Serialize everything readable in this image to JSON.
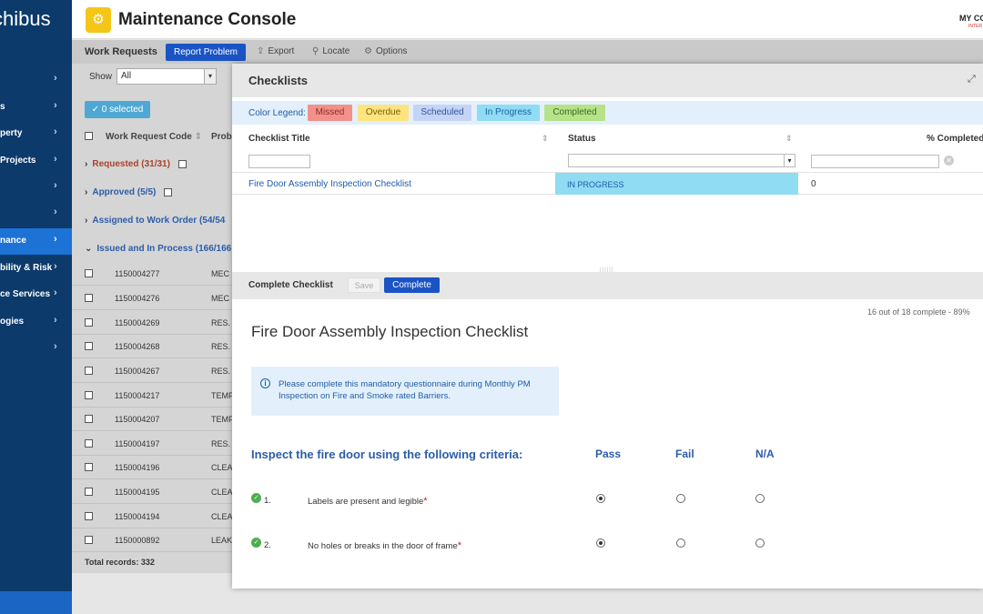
{
  "sidebar": {
    "brand": "chibus",
    "items": [
      {
        "label": ""
      },
      {
        "label": "s"
      },
      {
        "label": "perty"
      },
      {
        "label": "Projects"
      },
      {
        "label": ""
      },
      {
        "label": ""
      },
      {
        "label": "nance"
      },
      {
        "label": "bility & Risk"
      },
      {
        "label": "ce Services"
      },
      {
        "label": "ogies"
      },
      {
        "label": ""
      }
    ]
  },
  "header": {
    "title": "Maintenance Console",
    "company": "MY CO",
    "company_sub": "INTER"
  },
  "toolbar": {
    "title": "Work Requests",
    "report_problem": "Report Problem",
    "export": "Export",
    "locate": "Locate",
    "options": "Options"
  },
  "work_requests": {
    "show_label": "Show",
    "show_value": "All",
    "selected": "0 selected",
    "columns": [
      "Work Request Code",
      "Probl"
    ],
    "groups": [
      {
        "label": "Requested (31/31)"
      },
      {
        "label": "Approved (5/5)"
      },
      {
        "label": "Assigned to Work Order (54/54"
      },
      {
        "label": "Issued and In Process (166/166"
      }
    ],
    "rows": [
      {
        "code": "1150004277",
        "problem": "MEC"
      },
      {
        "code": "1150004276",
        "problem": "MEC"
      },
      {
        "code": "1150004269",
        "problem": "RES."
      },
      {
        "code": "1150004268",
        "problem": "RES."
      },
      {
        "code": "1150004267",
        "problem": "RES."
      },
      {
        "code": "1150004217",
        "problem": "TEMP"
      },
      {
        "code": "1150004207",
        "problem": "TEMP"
      },
      {
        "code": "1150004197",
        "problem": "RES."
      },
      {
        "code": "1150004196",
        "problem": "CLEA"
      },
      {
        "code": "1150004195",
        "problem": "CLEA"
      },
      {
        "code": "1150004194",
        "problem": "CLEA"
      },
      {
        "code": "1150000892",
        "problem": "LEAK"
      }
    ],
    "total": "Total records: 332"
  },
  "checklists_modal": {
    "title": "Checklists",
    "legend_label": "Color Legend:",
    "legend": [
      {
        "label": "Missed",
        "bg": "#f4908a",
        "fg": "#8a2c26"
      },
      {
        "label": "Overdue",
        "bg": "#fde47f",
        "fg": "#7a5e08"
      },
      {
        "label": "Scheduled",
        "bg": "#c5d4f5",
        "fg": "#2f52a3"
      },
      {
        "label": "In Progress",
        "bg": "#8fdcf3",
        "fg": "#1f5ca8"
      },
      {
        "label": "Completed",
        "bg": "#b6e28a",
        "fg": "#3c6a1a"
      }
    ],
    "columns": {
      "title": "Checklist Title",
      "status": "Status",
      "pct": "% Completed"
    },
    "row": {
      "title": "Fire Door Assembly Inspection Checklist",
      "status": "IN PROGRESS",
      "pct": "0"
    }
  },
  "complete_checklist": {
    "bar_title": "Complete Checklist",
    "save": "Save",
    "complete": "Complete",
    "progress": "16 out of 18 complete - 89%",
    "title": "Fire Door Assembly Inspection Checklist",
    "info": "Please complete this mandatory questionnaire during Monthly PM Inspection on Fire and Smoke rated Barriers.",
    "section": "Inspect the fire door using the following criteria:",
    "options": [
      "Pass",
      "Fail",
      "N/A"
    ],
    "questions": [
      {
        "num": "1.",
        "text": "Labels are present and legible",
        "required": "*",
        "selected": "Pass"
      },
      {
        "num": "2.",
        "text": "No holes or breaks in the door of frame",
        "required": "*",
        "selected": "Pass"
      }
    ]
  }
}
